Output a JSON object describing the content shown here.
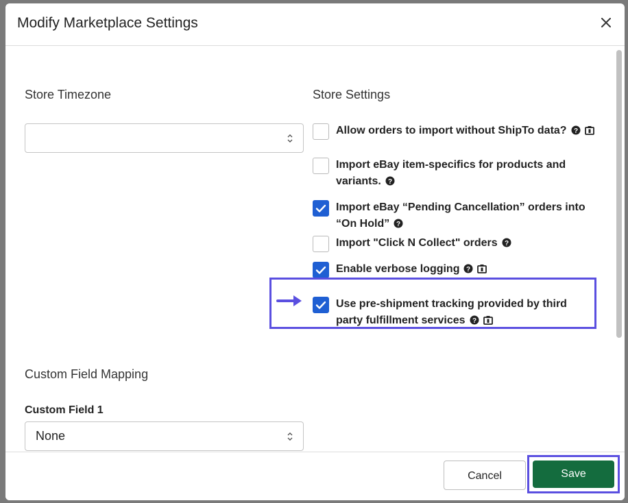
{
  "modal": {
    "title": "Modify Marketplace Settings",
    "close_label": "×"
  },
  "timezone": {
    "heading": "Store Timezone",
    "value": ""
  },
  "store_settings": {
    "heading": "Store Settings",
    "items": [
      {
        "label": "Allow orders to import without ShipTo data?",
        "checked": false,
        "icons": [
          "help-icon",
          "clipboard-icon"
        ]
      },
      {
        "label": "Import eBay item-specifics for products and variants.",
        "checked": false,
        "icons": [
          "help-icon"
        ]
      },
      {
        "label": "Import eBay “Pending Cancellation” orders into “On Hold”",
        "checked": true,
        "icons": [
          "help-icon"
        ]
      },
      {
        "label": "Import \"Click N Collect\" orders",
        "checked": false,
        "icons": [
          "help-icon"
        ]
      },
      {
        "label": "Enable verbose logging",
        "checked": true,
        "icons": [
          "help-icon",
          "clipboard-icon"
        ]
      },
      {
        "label": "Use pre-shipment tracking provided by third party fulfillment services",
        "checked": true,
        "icons": [
          "help-icon",
          "clipboard-icon"
        ]
      }
    ]
  },
  "custom_field_mapping": {
    "heading": "Custom Field Mapping",
    "field1_label": "Custom Field 1",
    "field1_value": "None"
  },
  "footer": {
    "cancel_label": "Cancel",
    "save_label": "Save"
  },
  "colors": {
    "checkbox_checked": "#1f5fd3",
    "save_button": "#146c3e",
    "annotation": "#5a4fe0"
  }
}
